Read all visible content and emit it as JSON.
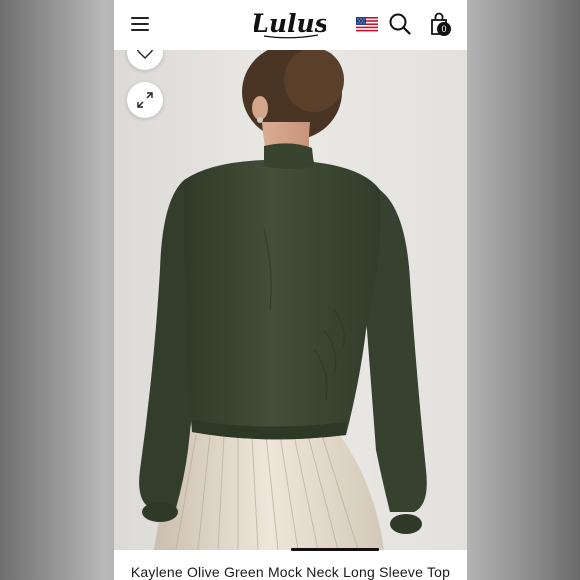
{
  "header": {
    "brand": "Lulus",
    "cart_count": "0"
  },
  "icons": {
    "menu": "hamburger-menu-icon",
    "flag": "us-flag-icon",
    "search": "search-icon",
    "cart": "shopping-bag-icon",
    "wishlist": "heart-icon",
    "expand": "expand-arrows-icon"
  },
  "product": {
    "title": "Kaylene Olive Green Mock Neck Long Sleeve Top"
  },
  "colors": {
    "top": "#3c4a33",
    "skirt": "#e6ddd0",
    "background": "#e2e0dd"
  }
}
